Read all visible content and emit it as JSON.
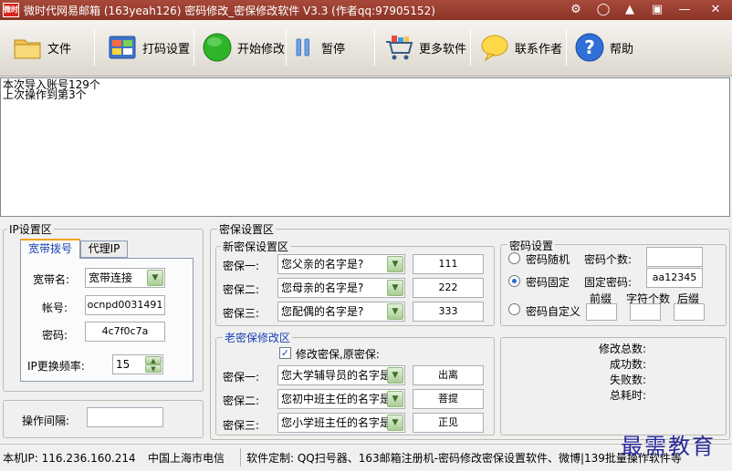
{
  "window": {
    "app_icon_text": "微时代",
    "title": "微时代网易邮箱 (163yeah126) 密码修改_密保修改软件 V3.3  (作者qq:97905152)"
  },
  "toolbar": {
    "file": "文件",
    "code_settings": "打码设置",
    "start": "开始修改",
    "pause": "暂停",
    "more_software": "更多软件",
    "contact": "联系作者",
    "help": "帮助"
  },
  "log": {
    "line1": "本次导入账号129个",
    "line2": "上次操作到第3个"
  },
  "ip_section": {
    "title": "IP设置区",
    "tab_broadband": "宽带拨号",
    "tab_proxy": "代理IP",
    "name_label": "宽带名:",
    "name_value": "宽带连接",
    "account_label": "帐号:",
    "account_value": "ocnpd0031491",
    "password_label": "密码:",
    "password_value": "4c7f0c7a",
    "freq_label": "IP更换频率:",
    "freq_value": "15"
  },
  "interval": {
    "label": "操作间隔:",
    "value": ""
  },
  "security": {
    "title": "密保设置区",
    "new_title": "新密保设置区",
    "q1_label": "密保一:",
    "q2_label": "密保二:",
    "q3_label": "密保三:",
    "new_q1": "您父亲的名字是?",
    "new_q2": "您母亲的名字是?",
    "new_q3": "您配偶的名字是?",
    "new_a1": "111",
    "new_a2": "222",
    "new_a3": "333",
    "old_title": "老密保修改区",
    "old_checkbox": "修改密保,原密保:",
    "old_q1": "您大学辅导员的名字是?",
    "old_q2": "您初中班主任的名字是?",
    "old_q3": "您小学班主任的名字是?",
    "old_a1": "出离",
    "old_a2": "菩提",
    "old_a3": "正见"
  },
  "password": {
    "title": "密码设置",
    "random_label": "密码随机",
    "count_label": "密码个数:",
    "count_value": "",
    "fixed_label": "密码固定",
    "fixed_value_label": "固定密码:",
    "fixed_value": "aa12345",
    "prefix_label": "前缀",
    "char_count_label": "字符个数",
    "suffix_label": "后缀",
    "custom_label": "密码自定义"
  },
  "stats": {
    "total_label": "修改总数:",
    "success_label": "成功数:",
    "fail_label": "失败数:",
    "time_label": "总耗时:"
  },
  "statusbar": {
    "ip": "本机IP: 116.236.160.214",
    "isp": "中国上海市电信",
    "custom": "软件定制: QQ扫号器、163邮箱注册机-密码修改密保设置软件、微博|139批量操作软件等"
  },
  "watermark": "最需教育",
  "colors": {
    "titlebar": "#8b3327",
    "accent_blue": "#1a3fb5",
    "dropdown_green": "#a9cd93"
  }
}
